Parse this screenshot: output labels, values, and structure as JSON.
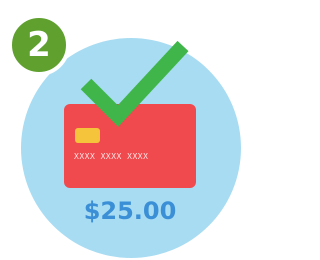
{
  "step": {
    "number": "2"
  },
  "card": {
    "number_mask": "XXXX XXXX XXXX"
  },
  "payment": {
    "amount": "$25.00"
  },
  "icons": {
    "circle": "background-circle-icon",
    "card": "credit-card-icon",
    "chip": "card-chip-icon",
    "check": "checkmark-icon"
  },
  "colors": {
    "circle": "#a8dcf2",
    "badge": "#5fa02f",
    "card": "#f04a4f",
    "chip": "#f6c43a",
    "check": "#3fb54a",
    "amount": "#3a8fd6"
  }
}
